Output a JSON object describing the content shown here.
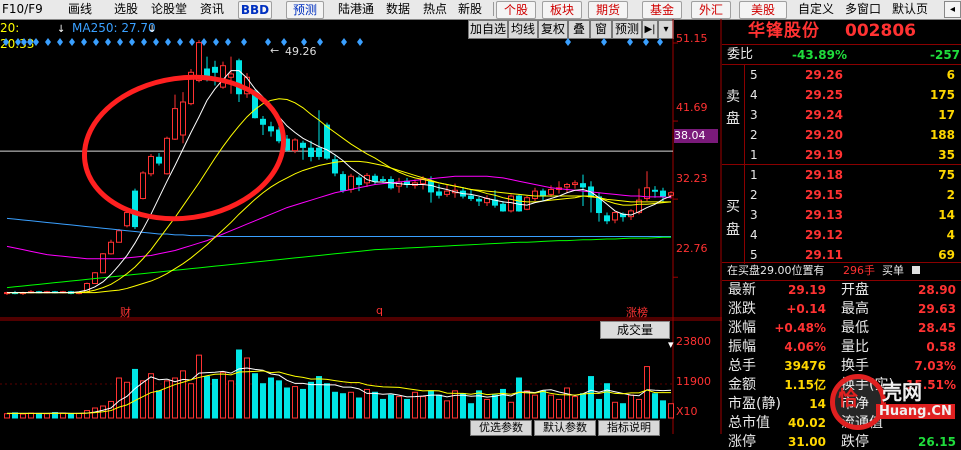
{
  "toolbar": {
    "left_items": [
      "F10/F9",
      "画线",
      "选股",
      "论股堂",
      "资讯"
    ],
    "bbd": "BBD",
    "forecast": "预测",
    "mid_items": [
      "陆港通",
      "数据",
      "热点",
      "新股"
    ],
    "tabs": [
      "个股",
      "板块",
      "期货",
      "基金",
      "外汇",
      "美股"
    ],
    "right_items": [
      "自定义",
      "多窗口",
      "默认页"
    ]
  },
  "info": {
    "ma20": "20: 20.33",
    "ma250": "MA250: 27.70"
  },
  "chart_tools": [
    "加自选",
    "均线",
    "复权",
    "叠",
    "窗",
    "预测",
    "▶|"
  ],
  "main_chart": {
    "price_labels": [
      "51.15",
      "41.69",
      "38.04",
      "32.23",
      "22.76"
    ],
    "peak_label": "49.26",
    "current_price_tag": "38.04",
    "markers": [
      "财",
      "q",
      "涨榜"
    ]
  },
  "volume": {
    "selector": "成交量",
    "labels": [
      "23800",
      "11900",
      "X10"
    ],
    "bottom_buttons": [
      "优选参数",
      "默认参数",
      "指标说明"
    ]
  },
  "chart_data": {
    "type": "candlestick",
    "ylim": [
      20,
      52
    ],
    "candles": [
      [
        20.8,
        20.9,
        20.6,
        21.0
      ],
      [
        20.9,
        20.8,
        20.7,
        21.1
      ],
      [
        20.8,
        20.9,
        20.6,
        21.0
      ],
      [
        20.9,
        21.0,
        20.8,
        21.2
      ],
      [
        21.0,
        20.9,
        20.8,
        21.1
      ],
      [
        20.9,
        21.0,
        20.8,
        21.1
      ],
      [
        21.0,
        20.9,
        20.8,
        21.1
      ],
      [
        20.9,
        21.0,
        20.8,
        21.1
      ],
      [
        21.0,
        20.8,
        20.7,
        21.1
      ],
      [
        20.8,
        20.9,
        20.7,
        21.0
      ],
      [
        20.9,
        22.0,
        20.9,
        22.1
      ],
      [
        22.0,
        23.3,
        22.0,
        23.4
      ],
      [
        23.3,
        25.6,
        23.3,
        25.7
      ],
      [
        25.6,
        27.0,
        25.5,
        27.3
      ],
      [
        27.0,
        28.4,
        27.0,
        28.6
      ],
      [
        29.0,
        30.6,
        28.8,
        30.8
      ],
      [
        33.2,
        28.9,
        28.6,
        33.5
      ],
      [
        32.3,
        35.4,
        32.2,
        35.6
      ],
      [
        35.3,
        37.4,
        35.0,
        37.7
      ],
      [
        37.3,
        36.6,
        36.3,
        37.8
      ],
      [
        35.3,
        39.6,
        35.2,
        39.8
      ],
      [
        39.5,
        43.2,
        39.4,
        44.9
      ],
      [
        40.0,
        44.0,
        39.0,
        45.2
      ],
      [
        43.8,
        47.6,
        43.6,
        48.0
      ],
      [
        46.6,
        51.2,
        46.4,
        51.5
      ],
      [
        48.0,
        47.0,
        46.5,
        49.5
      ],
      [
        48.2,
        47.6,
        46.0,
        49.0
      ],
      [
        45.8,
        48.4,
        45.6,
        48.9
      ],
      [
        47.0,
        47.4,
        45.0,
        49.5
      ],
      [
        49.0,
        45.0,
        44.0,
        49.26
      ],
      [
        45.0,
        47.0,
        44.5,
        47.5
      ],
      [
        45.3,
        42.1,
        42.0,
        45.5
      ],
      [
        41.9,
        41.3,
        40.0,
        42.3
      ],
      [
        41.0,
        40.5,
        39.8,
        41.6
      ],
      [
        40.6,
        39.3,
        39.0,
        41.0
      ],
      [
        39.5,
        38.2,
        38.0,
        40.0
      ],
      [
        38.1,
        39.4,
        37.8,
        39.6
      ],
      [
        39.0,
        38.5,
        37.0,
        39.3
      ],
      [
        38.4,
        37.4,
        36.8,
        39.3
      ],
      [
        38.4,
        37.4,
        37.0,
        43.0
      ],
      [
        41.2,
        37.2,
        37.0,
        41.5
      ],
      [
        37.0,
        35.4,
        35.0,
        37.5
      ],
      [
        35.2,
        33.3,
        33.0,
        35.6
      ],
      [
        33.4,
        35.0,
        33.0,
        35.3
      ],
      [
        34.8,
        34.0,
        33.2,
        35.1
      ],
      [
        34.2,
        35.1,
        33.7,
        35.4
      ],
      [
        35.0,
        34.4,
        34.0,
        35.3
      ],
      [
        34.6,
        34.5,
        34.2,
        35.0
      ],
      [
        34.6,
        33.6,
        33.4,
        35.0
      ],
      [
        33.8,
        34.3,
        33.0,
        34.8
      ],
      [
        34.4,
        34.0,
        33.6,
        34.8
      ],
      [
        33.9,
        34.2,
        33.5,
        34.6
      ],
      [
        34.1,
        34.7,
        33.4,
        35.0
      ],
      [
        34.4,
        33.1,
        31.8,
        35.0
      ],
      [
        33.1,
        32.7,
        32.3,
        34.0
      ],
      [
        32.8,
        33.2,
        32.5,
        34.0
      ],
      [
        33.0,
        33.3,
        32.4,
        34.1
      ],
      [
        33.2,
        32.6,
        32.3,
        33.7
      ],
      [
        32.6,
        32.3,
        32.0,
        33.4
      ],
      [
        32.2,
        32.0,
        31.4,
        32.5
      ],
      [
        31.8,
        32.3,
        31.4,
        32.7
      ],
      [
        32.1,
        31.5,
        31.2,
        33.3
      ],
      [
        31.6,
        30.8,
        30.7,
        32.0
      ],
      [
        30.8,
        32.6,
        30.6,
        32.8
      ],
      [
        32.6,
        30.8,
        30.7,
        32.8
      ],
      [
        31.0,
        32.4,
        30.9,
        32.6
      ],
      [
        32.3,
        33.2,
        32.0,
        33.6
      ],
      [
        33.2,
        32.6,
        32.0,
        33.5
      ],
      [
        32.8,
        33.4,
        32.5,
        33.9
      ],
      [
        33.4,
        33.6,
        32.9,
        34.4
      ],
      [
        33.7,
        34.0,
        33.0,
        34.2
      ],
      [
        34.0,
        34.2,
        33.5,
        34.5
      ],
      [
        34.1,
        33.7,
        31.4,
        35.2
      ],
      [
        33.7,
        32.5,
        30.6,
        34.4
      ],
      [
        32.5,
        30.6,
        29.5,
        33.0
      ],
      [
        30.2,
        29.6,
        29.2,
        30.6
      ],
      [
        29.7,
        30.6,
        29.3,
        30.7
      ],
      [
        30.4,
        30.1,
        29.5,
        30.6
      ],
      [
        30.1,
        30.8,
        29.7,
        31.0
      ],
      [
        30.6,
        32.1,
        30.4,
        33.5
      ],
      [
        32.3,
        33.6,
        32.0,
        35.6
      ],
      [
        33.3,
        33.2,
        32.4,
        33.8
      ],
      [
        33.2,
        32.6,
        31.8,
        33.6
      ],
      [
        32.7,
        33.0,
        32.3,
        33.2
      ]
    ],
    "ma5": [
      20.9,
      20.9,
      20.9,
      20.9,
      20.9,
      20.9,
      20.9,
      20.9,
      20.9,
      21.0,
      21.2,
      21.6,
      22.2,
      23.1,
      24.2,
      25.4,
      26.9,
      28.6,
      30.4,
      32.4,
      34.4,
      36.3,
      38.3,
      40.3,
      42.2,
      44.2,
      45.6,
      46.7,
      47.8,
      47.8,
      46.9,
      45.6,
      44.6,
      43.0,
      42.2,
      41.1,
      40.3,
      39.6,
      39.1,
      38.6,
      38.2,
      37.6,
      36.9,
      36.0,
      35.3,
      34.6,
      34.3,
      34.3,
      34.2,
      34.1,
      34.0,
      34.0,
      34.0,
      33.9,
      33.6,
      33.4,
      33.1,
      32.9,
      32.8,
      32.6,
      32.3,
      32.1,
      31.9,
      31.8,
      31.6,
      31.5,
      31.8,
      32.0,
      32.3,
      32.6,
      33.0,
      33.3,
      33.4,
      33.1,
      32.4,
      31.6,
      30.8,
      30.4,
      30.3,
      30.7,
      31.2,
      31.6,
      32.2,
      32.6
    ],
    "ma10": [
      20.9,
      20.9,
      20.9,
      20.9,
      20.9,
      20.9,
      20.9,
      20.9,
      20.9,
      20.9,
      21.0,
      21.2,
      21.5,
      21.9,
      22.5,
      23.2,
      24.0,
      25.0,
      26.1,
      27.4,
      28.7,
      30.0,
      31.4,
      32.8,
      34.2,
      35.7,
      37.2,
      38.6,
      39.9,
      41.1,
      42.2,
      43.1,
      43.8,
      44.2,
      44.4,
      44.3,
      43.9,
      43.3,
      42.5,
      41.8,
      41.0,
      40.3,
      39.6,
      38.9,
      38.3,
      37.7,
      37.2,
      36.6,
      36.0,
      35.5,
      35.1,
      34.8,
      34.6,
      34.4,
      34.2,
      34.0,
      33.8,
      33.6,
      33.4,
      33.2,
      32.9,
      32.7,
      32.4,
      32.2,
      32.0,
      31.9,
      31.9,
      32.0,
      32.1,
      32.2,
      32.3,
      32.4,
      32.6,
      32.6,
      32.4,
      32.0,
      31.7,
      31.5,
      31.5,
      31.6,
      31.6,
      31.7,
      31.8,
      31.9
    ],
    "ma20": [
      20.9,
      20.9,
      20.9,
      20.9,
      20.9,
      20.9,
      20.9,
      20.9,
      20.9,
      20.9,
      20.9,
      20.9,
      21.0,
      21.1,
      21.2,
      21.4,
      21.7,
      22.0,
      22.3,
      22.7,
      23.2,
      23.8,
      24.4,
      25.1,
      25.9,
      26.7,
      27.6,
      28.5,
      29.4,
      30.4,
      31.3,
      32.2,
      33.0,
      33.7,
      34.3,
      34.8,
      35.3,
      35.7,
      36.0,
      36.3,
      36.5,
      36.7,
      36.8,
      36.8,
      36.8,
      36.7,
      36.5,
      36.3,
      36.0,
      35.7,
      35.4,
      35.1,
      34.8,
      34.5,
      34.2,
      34.0,
      33.8,
      33.6,
      33.4,
      33.3,
      33.2,
      33.1,
      33.0,
      32.9,
      32.8,
      32.7,
      32.6,
      32.6,
      32.6,
      32.6,
      32.6,
      32.6,
      32.6,
      32.5,
      32.4,
      32.2,
      32.1,
      32.0,
      31.9,
      31.9,
      31.9,
      31.9,
      31.9,
      31.9
    ],
    "ma60": [
      26.5,
      26.3,
      26.1,
      25.9,
      25.7,
      25.5,
      25.4,
      25.3,
      25.2,
      25.1,
      25.0,
      25.0,
      25.0,
      25.0,
      25.0,
      25.1,
      25.2,
      25.3,
      25.4,
      25.6,
      25.8,
      26.0,
      26.3,
      26.6,
      26.9,
      27.2,
      27.6,
      28.0,
      28.4,
      28.8,
      29.2,
      29.6,
      30.0,
      30.4,
      30.8,
      31.2,
      31.5,
      31.8,
      32.1,
      32.4,
      32.7,
      33.0,
      33.2,
      33.4,
      33.6,
      33.8,
      34.0,
      34.1,
      34.2,
      34.3,
      34.4,
      34.5,
      34.6,
      34.7,
      34.8,
      34.9,
      35.0,
      35.0,
      35.0,
      35.0,
      35.0,
      34.9,
      34.8,
      34.6,
      34.4,
      34.2,
      34.0,
      33.8,
      33.6,
      33.5,
      33.4,
      33.3,
      33.2,
      33.1,
      33.0,
      32.9,
      32.8,
      32.7,
      32.6,
      32.6,
      32.5,
      32.5,
      32.5,
      32.4
    ],
    "ma250": [
      29.9,
      29.8,
      29.7,
      29.6,
      29.5,
      29.4,
      29.3,
      29.2,
      29.1,
      29.0,
      28.9,
      28.8,
      28.7,
      28.6,
      28.5,
      28.4,
      28.3,
      28.2,
      28.1,
      28.0,
      28.0,
      27.9,
      27.9,
      27.8,
      27.8,
      27.8,
      27.7,
      27.7,
      27.7,
      27.7,
      27.7,
      27.7,
      27.7,
      27.7,
      27.7,
      27.7,
      27.7,
      27.7,
      27.7,
      27.7,
      27.7,
      27.7,
      27.7,
      27.7,
      27.7,
      27.7,
      27.7,
      27.7,
      27.7,
      27.7,
      27.7,
      27.7,
      27.7,
      27.7,
      27.7,
      27.7,
      27.7,
      27.7,
      27.7,
      27.7,
      27.7,
      27.7,
      27.7,
      27.7,
      27.7,
      27.7,
      27.7,
      27.7,
      27.7,
      27.7,
      27.7,
      27.7,
      27.7,
      27.7,
      27.7,
      27.7,
      27.7,
      27.7,
      27.7,
      27.7,
      27.7,
      27.7,
      27.7,
      27.7
    ],
    "ma_long": [
      21.5,
      21.6,
      21.7,
      21.8,
      21.9,
      22.0,
      22.1,
      22.2,
      22.3,
      22.4,
      22.5,
      22.6,
      22.7,
      22.8,
      22.9,
      23.0,
      23.1,
      23.2,
      23.3,
      23.4,
      23.5,
      23.6,
      23.7,
      23.8,
      23.9,
      24.0,
      24.1,
      24.2,
      24.3,
      24.4,
      24.5,
      24.6,
      24.7,
      24.8,
      24.9,
      25.0,
      25.1,
      25.2,
      25.3,
      25.4,
      25.5,
      25.6,
      25.7,
      25.8,
      25.9,
      26.0,
      26.1,
      26.15,
      26.2,
      26.25,
      26.3,
      26.35,
      26.4,
      26.45,
      26.5,
      26.55,
      26.6,
      26.65,
      26.7,
      26.75,
      26.8,
      26.85,
      26.9,
      26.95,
      27.0,
      27.0,
      27.05,
      27.1,
      27.15,
      27.2,
      27.2,
      27.25,
      27.3,
      27.3,
      27.35,
      27.4,
      27.4,
      27.45,
      27.5,
      27.5,
      27.5,
      27.55,
      27.6,
      27.6
    ],
    "volume_ylim": [
      0,
      28000
    ],
    "volumes": [
      1500,
      1800,
      1400,
      1700,
      1600,
      1500,
      1900,
      1700,
      1400,
      1600,
      2600,
      3500,
      4200,
      5800,
      14000,
      12500,
      17000,
      13000,
      15500,
      9500,
      13000,
      14000,
      16500,
      12000,
      22000,
      14500,
      13500,
      16000,
      13000,
      23800,
      21000,
      15500,
      12000,
      14000,
      13000,
      10500,
      11000,
      10000,
      12500,
      14500,
      12000,
      9000,
      8500,
      9000,
      7000,
      10000,
      9000,
      6500,
      8000,
      7500,
      6500,
      9000,
      7500,
      9500,
      8000,
      6000,
      9500,
      8500,
      5000,
      9500,
      6500,
      8000,
      10000,
      5500,
      14000,
      9500,
      8000,
      9500,
      8000,
      6500,
      10500,
      7500,
      8500,
      14500,
      6500,
      12000,
      5500,
      5000,
      8000,
      6500,
      18000,
      8500,
      6000,
      5000
    ],
    "vol_ma5": [
      1600,
      1600,
      1600,
      1600,
      1600,
      1600,
      1700,
      1700,
      1600,
      1600,
      1700,
      2100,
      2700,
      3500,
      6000,
      7600,
      10300,
      12400,
      14400,
      13400,
      13600,
      12700,
      13500,
      13300,
      15700,
      15900,
      16000,
      16300,
      15700,
      17200,
      17500,
      17000,
      16700,
      15400,
      15000,
      13200,
      12100,
      12100,
      11700,
      11700,
      11600,
      11600,
      10800,
      10800,
      10200,
      8600,
      8600,
      8300,
      8500,
      8000,
      7400,
      7500,
      7700,
      8000,
      8000,
      7400,
      7900,
      8000,
      7600,
      7800,
      7300,
      7600,
      8200,
      7700,
      9000,
      9200,
      8900,
      9700,
      9900,
      9100,
      8500,
      7900,
      8500,
      9700,
      9000,
      9800,
      9200,
      8600,
      8000,
      7800,
      9900,
      9700,
      9600,
      9700
    ],
    "vol_ma10": [
      1600,
      1600,
      1600,
      1600,
      1600,
      1600,
      1600,
      1600,
      1600,
      1600,
      1700,
      1900,
      2200,
      2600,
      3800,
      4600,
      6100,
      7500,
      8900,
      9500,
      10600,
      11700,
      12500,
      13400,
      14200,
      14800,
      15300,
      15400,
      15100,
      16100,
      16200,
      16300,
      16500,
      15900,
      16100,
      15300,
      14600,
      14200,
      13600,
      13700,
      13500,
      13100,
      12700,
      12400,
      12400,
      11600,
      11200,
      10900,
      10800,
      10700,
      10300,
      9900,
      9500,
      9600,
      9500,
      8700,
      8600,
      8600,
      8300,
      8800,
      8200,
      8400,
      8600,
      8300,
      9000,
      8800,
      8700,
      9300,
      8600,
      8200,
      8100,
      8000,
      8400,
      8600,
      8600,
      9200,
      8600,
      8500,
      8800,
      8800,
      9800,
      8900,
      8900,
      8900
    ]
  },
  "quote": {
    "stock_name": "华锋股份",
    "stock_code": "002806",
    "webi_label": "委比",
    "webi_pct": "-43.89%",
    "webi_diff": "-257",
    "sell_side_label": [
      "卖",
      "盘"
    ],
    "buy_side_label": [
      "买",
      "盘"
    ],
    "sell": [
      {
        "lvl": "5",
        "price": "29.26",
        "vol": "6"
      },
      {
        "lvl": "4",
        "price": "29.25",
        "vol": "175"
      },
      {
        "lvl": "3",
        "price": "29.24",
        "vol": "17"
      },
      {
        "lvl": "2",
        "price": "29.20",
        "vol": "188"
      },
      {
        "lvl": "1",
        "price": "29.19",
        "vol": "35"
      }
    ],
    "buy": [
      {
        "lvl": "1",
        "price": "29.18",
        "vol": "75"
      },
      {
        "lvl": "2",
        "price": "29.15",
        "vol": "2"
      },
      {
        "lvl": "3",
        "price": "29.13",
        "vol": "14"
      },
      {
        "lvl": "4",
        "price": "29.12",
        "vol": "4"
      },
      {
        "lvl": "5",
        "price": "29.11",
        "vol": "69"
      }
    ],
    "buy_order_note": "在买盘29.00位置有",
    "buy_order_qty": "296手",
    "buy_order_tail": "买单",
    "stats": [
      {
        "l1": "最新",
        "v1": "29.19",
        "l2": "开盘",
        "v2": "28.90"
      },
      {
        "l1": "涨跌",
        "v1": "+0.14",
        "l2": "最高",
        "v2": "29.63"
      },
      {
        "l1": "涨幅",
        "v1": "+0.48%",
        "l2": "最低",
        "v2": "28.45"
      },
      {
        "l1": "振幅",
        "v1": "4.06%",
        "l2": "量比",
        "v2": "0.58"
      },
      {
        "l1": "总手",
        "v1": "39476",
        "l2": "换手",
        "v2": "7.03%"
      },
      {
        "l1": "金额",
        "v1": "1.15亿",
        "l2": "换手(实)",
        "v2": "15.51%"
      },
      {
        "l1": "市盈(静)",
        "v1": "14",
        "l2": "市净",
        "v2": ""
      },
      {
        "l1": "总市值",
        "v1": "40.02",
        "l2": "流通值",
        "v2": ""
      },
      {
        "l1": "涨停",
        "v1": "31.00",
        "l2": "跌停",
        "v2": "26.15"
      }
    ]
  },
  "watermark": {
    "text1": "恰",
    "text2": "壳网",
    "text3": "Huang.CN"
  },
  "colors": {
    "up": "#ff3232",
    "down": "#00e6e6",
    "ma5": "#ffffff",
    "ma10": "#ffff00",
    "ma20": "#ff00ff",
    "ma60": "#00ff00",
    "ma250": "#3aa0ff",
    "circle": "#ff2020"
  }
}
